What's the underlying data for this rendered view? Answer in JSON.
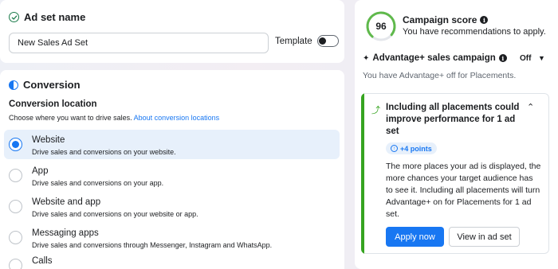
{
  "adset": {
    "title": "Ad set name",
    "name_value": "New Sales Ad Set",
    "template_label": "Template"
  },
  "conversion": {
    "title": "Conversion",
    "location_label": "Conversion location",
    "location_desc": "Choose where you want to drive sales.",
    "location_link": "About conversion locations",
    "options": [
      {
        "title": "Website",
        "desc": "Drive sales and conversions on your website.",
        "selected": true
      },
      {
        "title": "App",
        "desc": "Drive sales and conversions on your app.",
        "selected": false
      },
      {
        "title": "Website and app",
        "desc": "Drive sales and conversions on your website or app.",
        "selected": false
      },
      {
        "title": "Messaging apps",
        "desc": "Drive sales and conversions through Messenger, Instagram and WhatsApp.",
        "selected": false
      },
      {
        "title": "Calls",
        "desc": "",
        "selected": false
      }
    ]
  },
  "score": {
    "value": "96",
    "title": "Campaign score",
    "subtitle": "You have recommendations to apply."
  },
  "advantage": {
    "title": "Advantage+ sales campaign",
    "status": "Off",
    "desc": "You have Advantage+ off for Placements."
  },
  "recommendation": {
    "title": "Including all placements could improve performance for 1 ad set",
    "badge": "+4 points",
    "body": "The more places your ad is displayed, the more chances your target audience has to see it. Including all placements will turn Advantage+ on for Placements for 1 ad set.",
    "apply_label": "Apply now",
    "view_label": "View in ad set"
  },
  "colors": {
    "accent": "#1877f2",
    "success": "#36a420",
    "score_ring": "#5fb94b"
  }
}
